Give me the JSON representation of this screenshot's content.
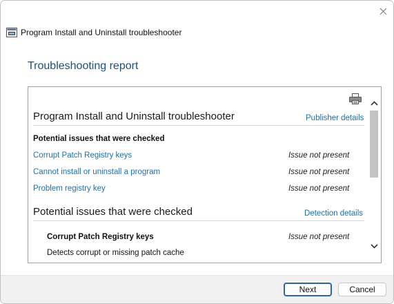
{
  "window": {
    "title": "Program Install and Uninstall troubleshooter",
    "icons": {
      "close": "close-icon",
      "app": "app-icon"
    }
  },
  "heading": "Troubleshooting report",
  "report": {
    "printer_icon": "printer-icon",
    "section1": {
      "title": "Program Install and Uninstall troubleshooter",
      "link": "Publisher details",
      "subheading": "Potential issues that were checked",
      "issues": [
        {
          "name": "Corrupt Patch Registry keys",
          "status": "Issue not present"
        },
        {
          "name": "Cannot install or uninstall a program",
          "status": "Issue not present"
        },
        {
          "name": "Problem registry key",
          "status": "Issue not present"
        }
      ]
    },
    "section2": {
      "title": "Potential issues that were checked",
      "link": "Detection details",
      "item": {
        "name": "Corrupt Patch Registry keys",
        "status": "Issue not present",
        "description": "Detects corrupt or missing patch cache"
      }
    }
  },
  "footer": {
    "next_label": "Next",
    "cancel_label": "Cancel"
  },
  "colors": {
    "heading": "#1e4e79",
    "link": "#1a6fb5",
    "primary_button_border": "#2b64b0",
    "footer_bg": "#f0f0f0",
    "scroll_thumb": "#c2c2c2"
  }
}
